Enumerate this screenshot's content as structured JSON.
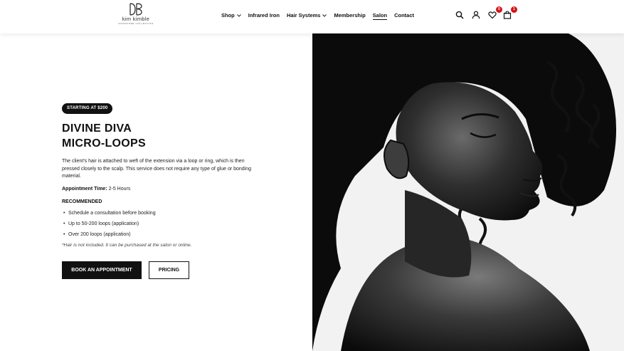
{
  "header": {
    "logo": {
      "name": "kim kimble",
      "tagline": "SIGNATURE COLLECTION"
    },
    "nav": [
      {
        "label": "Shop",
        "has_dropdown": true,
        "active": false
      },
      {
        "label": "Infrared Iron",
        "has_dropdown": false,
        "active": false
      },
      {
        "label": "Hair Systems",
        "has_dropdown": true,
        "active": false
      },
      {
        "label": "Membership",
        "has_dropdown": false,
        "active": false
      },
      {
        "label": "Salon",
        "has_dropdown": false,
        "active": true
      },
      {
        "label": "Contact",
        "has_dropdown": false,
        "active": false
      }
    ],
    "icons": {
      "search": "search-icon",
      "account": "user-icon",
      "wishlist": "heart-icon",
      "cart": "bag-icon"
    },
    "wishlist_count": "0",
    "cart_count": "1",
    "badge_color": "#d3141b"
  },
  "main": {
    "price_pill": "STARTING AT $200",
    "title_line1": "DIVINE DIVA",
    "title_line2": "MICRO-LOOPS",
    "description": "The client's hair is attached to weft of the extension via a loop or ring, which is then pressed closely to the scalp. This service does not require any type of glue or bonding material.",
    "appointment_label": "Appointment Time:",
    "appointment_value": "2-5 Hours",
    "recommended_heading": "RECOMMENDED",
    "recommended_items": [
      "Schedule a consultation before booking",
      "Up to 50-200 loops (application)",
      "Over 200 loops (application)"
    ],
    "note": "*Hair is not included. It can be purchased at the salon or online.",
    "book_button": "BOOK AN APPOINTMENT",
    "pricing_button": "PRICING"
  },
  "hero": {
    "alt": "Black and white portrait of a woman with curly hair in profile"
  }
}
